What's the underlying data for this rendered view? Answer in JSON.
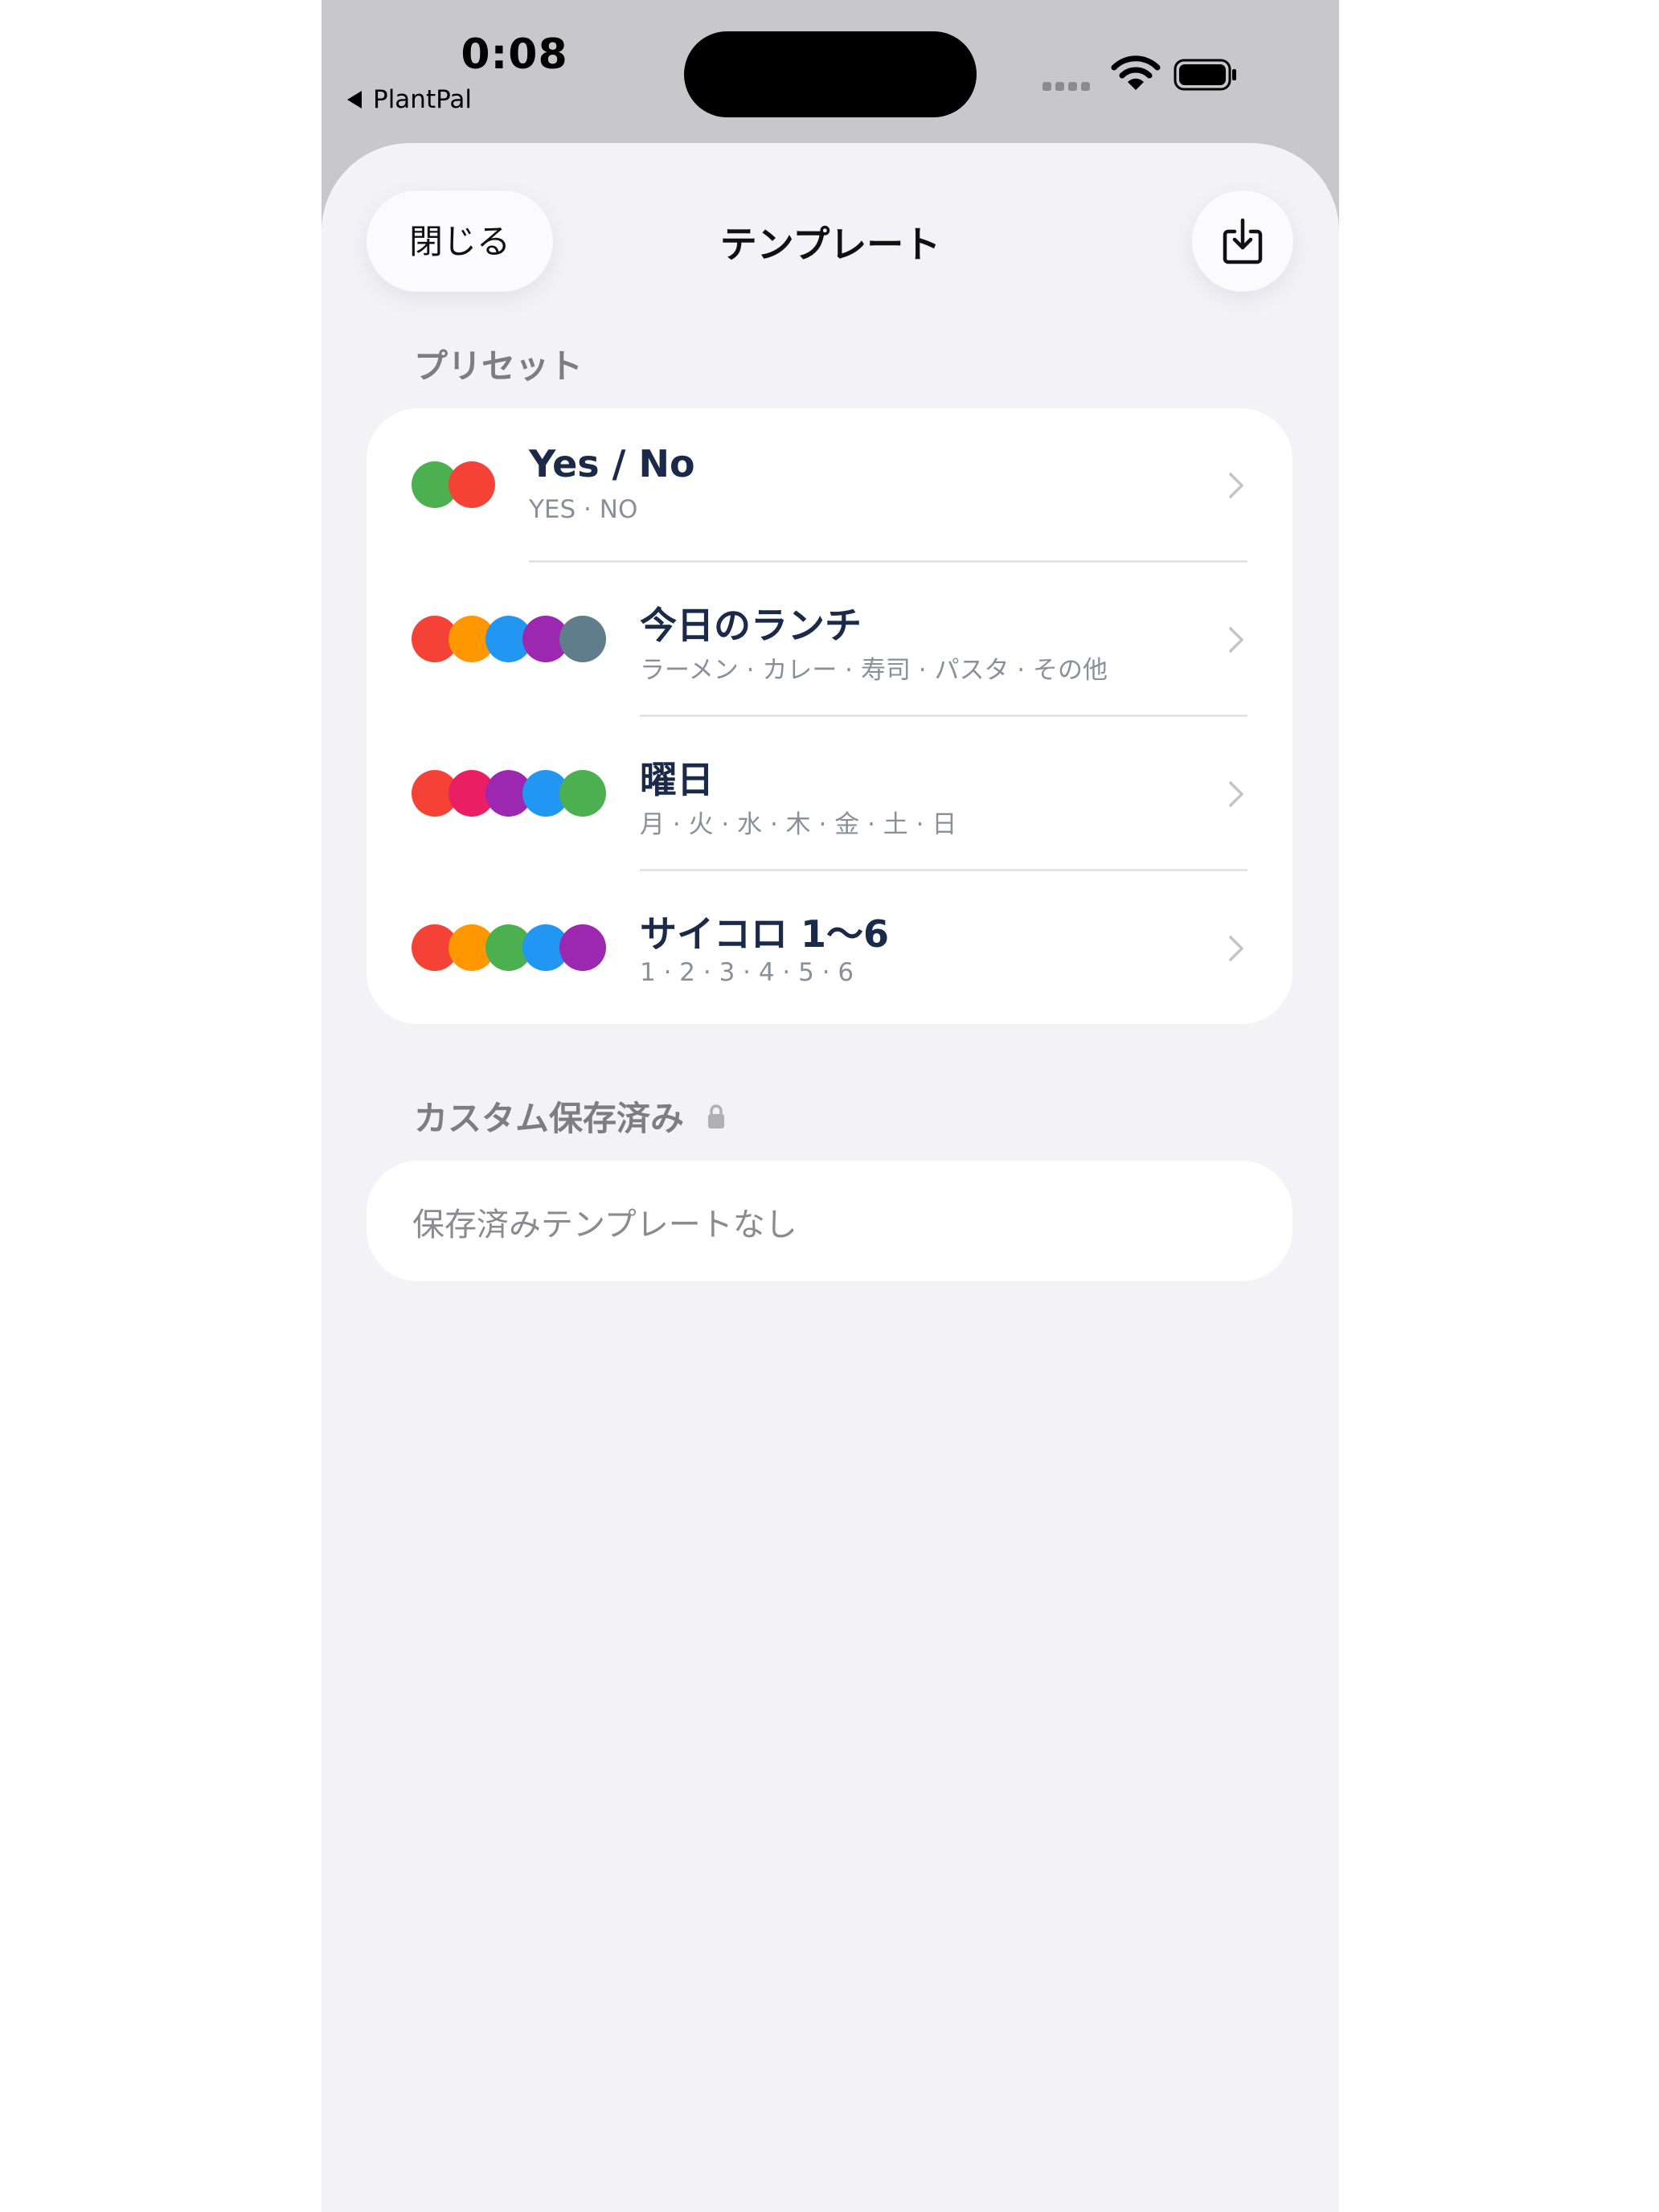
{
  "status_bar": {
    "time": "0:08",
    "back_app": "PlantPal"
  },
  "header": {
    "close_label": "閉じる",
    "title": "テンプレート",
    "import_icon": "tray-and-arrow-down-icon"
  },
  "presets": {
    "section_title": "プリセット",
    "items": [
      {
        "title": "Yes / No",
        "subtitle": "YES · NO",
        "colors": [
          "#4caf50",
          "#f44336"
        ]
      },
      {
        "title": "今日のランチ",
        "subtitle": "ラーメン · カレー · 寿司 · パスタ · その他",
        "colors": [
          "#f44336",
          "#ff9800",
          "#2196f3",
          "#9c27b0",
          "#607d8b"
        ]
      },
      {
        "title": "曜日",
        "subtitle": "月 · 火 · 水 · 木 · 金 · 土 · 日",
        "colors": [
          "#f44336",
          "#e91e63",
          "#9c27b0",
          "#2196f3",
          "#4caf50"
        ]
      },
      {
        "title": "サイコロ 1〜6",
        "subtitle": "1 · 2 · 3 · 4 · 5 · 6",
        "colors": [
          "#f44336",
          "#ff9800",
          "#4caf50",
          "#2196f3",
          "#9c27b0"
        ]
      }
    ]
  },
  "custom": {
    "section_title": "カスタム保存済み",
    "lock_icon": "lock-icon",
    "empty_text": "保存済みテンプレートなし"
  }
}
